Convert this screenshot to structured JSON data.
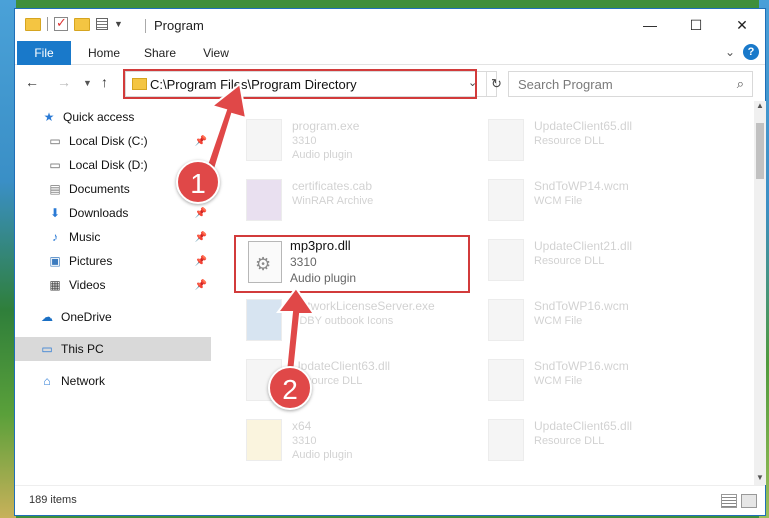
{
  "window": {
    "title": "Program"
  },
  "ribbon": {
    "tabs": [
      {
        "label": "File"
      },
      {
        "label": "Home"
      },
      {
        "label": "Share"
      },
      {
        "label": "View"
      }
    ]
  },
  "address": {
    "path": "C:\\Program Files\\Program Directory"
  },
  "search": {
    "placeholder": "Search Program"
  },
  "sidebar": {
    "items": [
      {
        "label": "Quick access",
        "icon": "star-icon"
      },
      {
        "label": "Local Disk (C:)",
        "icon": "drive-icon",
        "pinned": true
      },
      {
        "label": "Local Disk (D:)",
        "icon": "drive-icon"
      },
      {
        "label": "Documents",
        "icon": "documents-icon",
        "pinned": true
      },
      {
        "label": "Downloads",
        "icon": "download-icon",
        "pinned": true
      },
      {
        "label": "Music",
        "icon": "music-icon",
        "pinned": true
      },
      {
        "label": "Pictures",
        "icon": "pictures-icon",
        "pinned": true
      },
      {
        "label": "Videos",
        "icon": "videos-icon",
        "pinned": true
      },
      {
        "label": "OneDrive",
        "icon": "cloud-icon"
      },
      {
        "label": "This PC",
        "icon": "computer-icon",
        "selected": true
      },
      {
        "label": "Network",
        "icon": "network-icon"
      }
    ]
  },
  "files": {
    "left": [
      {
        "name": "program.exe",
        "sub1": "3310",
        "sub2": "Audio plugin"
      },
      {
        "name": "certificates.cab",
        "sub1": "WinRAR Archive",
        "sub2": ""
      },
      {
        "name": "mp3pro.dll",
        "sub1": "3310",
        "sub2": "Audio plugin"
      },
      {
        "name": "NetworkLicenseServer.exe",
        "sub1": "SDBY outbook Icons",
        "sub2": ""
      },
      {
        "name": "UpdateClient63.dll",
        "sub1": "Resource DLL",
        "sub2": ""
      },
      {
        "name": "x64",
        "sub1": "3310",
        "sub2": "Audio plugin"
      }
    ],
    "right": [
      {
        "name": "UpdateClient65.dll",
        "sub1": "Resource DLL"
      },
      {
        "name": "SndToWP14.wcm",
        "sub1": "WCM File"
      },
      {
        "name": "UpdateClient21.dll",
        "sub1": "Resource DLL"
      },
      {
        "name": "SndToWP16.wcm",
        "sub1": "WCM File"
      },
      {
        "name": "SndToWP16.wcm",
        "sub1": "WCM File"
      },
      {
        "name": "UpdateClient65.dll",
        "sub1": "Resource DLL"
      }
    ]
  },
  "status": {
    "item_count": "189 items"
  },
  "markers": [
    {
      "label": "1"
    },
    {
      "label": "2"
    }
  ],
  "colors": {
    "accent": "#1979ca",
    "highlight": "#d23b3b",
    "marker": "#e04848"
  }
}
